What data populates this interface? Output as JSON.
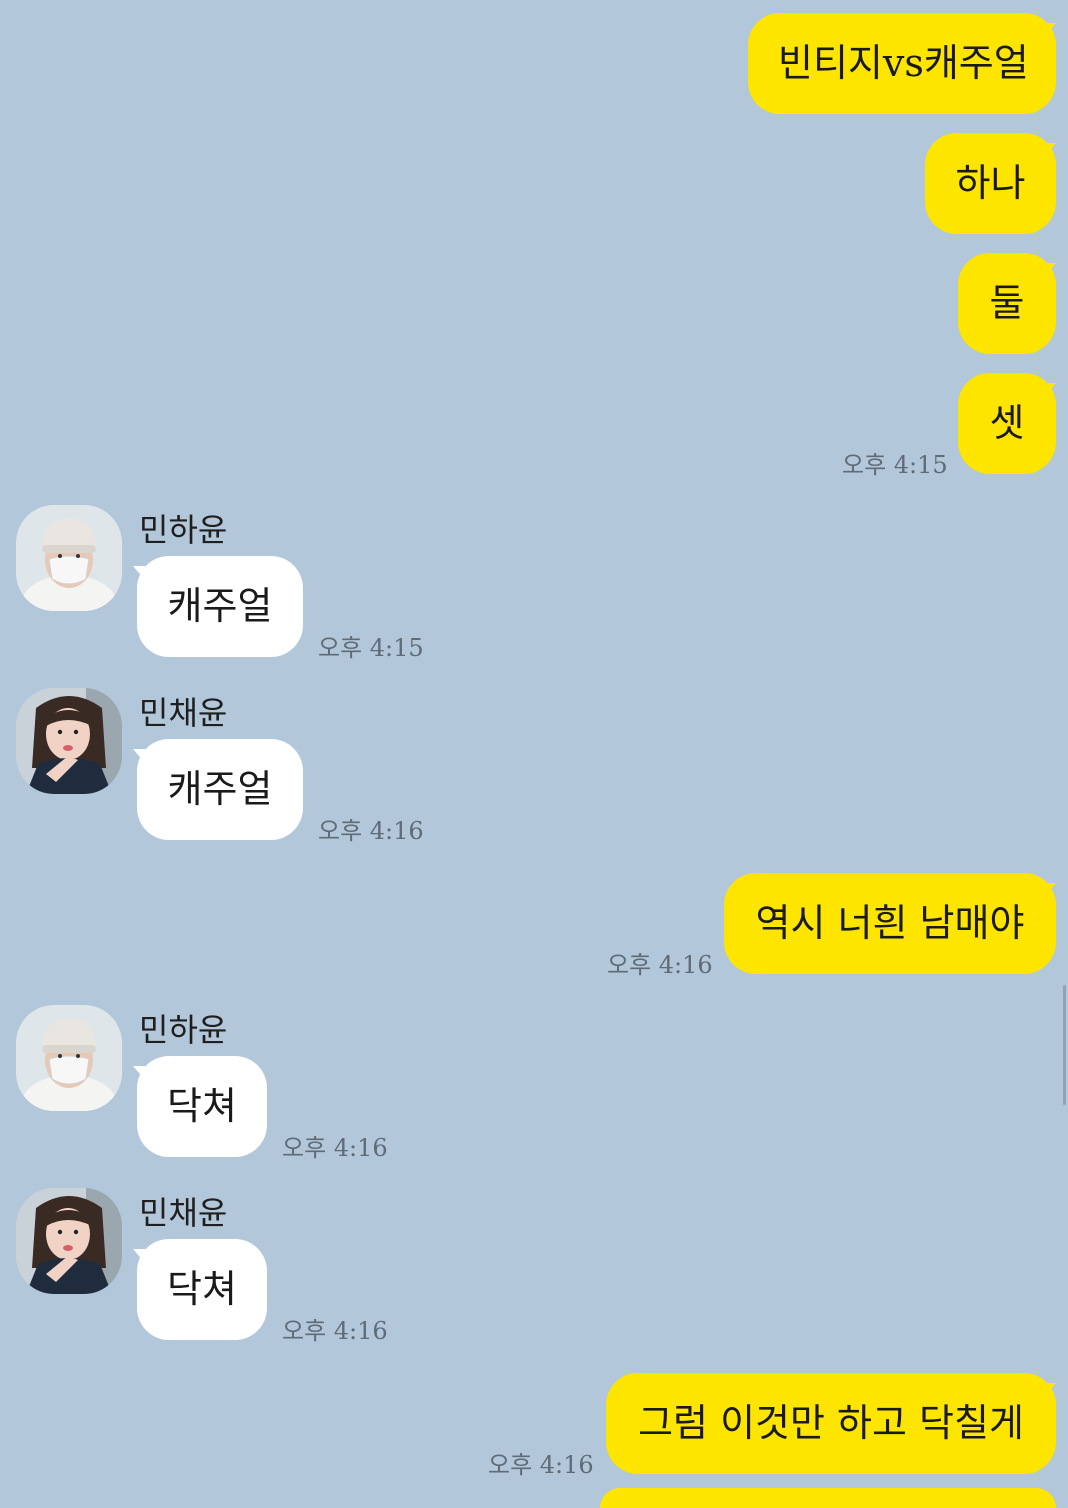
{
  "colors": {
    "background": "#b2c7da",
    "my_bubble": "#fee500",
    "their_bubble": "#ffffff",
    "timestamp": "#5f6b76"
  },
  "messages": [
    {
      "from": "me",
      "text": "빈티지vs캐주얼"
    },
    {
      "from": "me",
      "text": "하나"
    },
    {
      "from": "me",
      "text": "둘"
    },
    {
      "from": "me",
      "text": "셋",
      "time": "오후 4:15"
    },
    {
      "from": "민하윤",
      "sender": "민하윤",
      "text": "캐주얼",
      "time": "오후 4:15",
      "avatar": "avatar-hayun"
    },
    {
      "from": "민채윤",
      "sender": "민채윤",
      "text": "캐주얼",
      "time": "오후 4:16",
      "avatar": "avatar-chaeyun"
    },
    {
      "from": "me",
      "text": "역시 너흰 남매야",
      "time": "오후 4:16"
    },
    {
      "from": "민하윤",
      "sender": "민하윤",
      "text": "닥쳐",
      "time": "오후 4:16",
      "avatar": "avatar-hayun"
    },
    {
      "from": "민채윤",
      "sender": "민채윤",
      "text": "닥쳐",
      "time": "오후 4:16",
      "avatar": "avatar-chaeyun"
    },
    {
      "from": "me",
      "text": "그럼 이것만 하고 닥칠게",
      "time": "오후 4:16"
    }
  ]
}
